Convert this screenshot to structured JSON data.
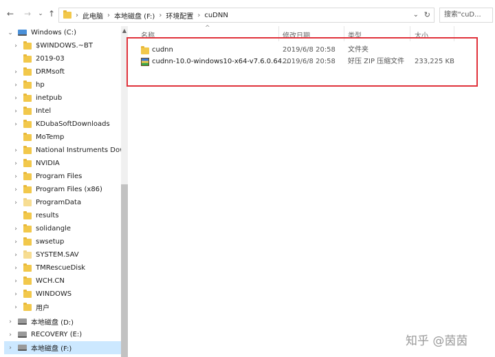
{
  "address_bar": {
    "breadcrumbs": [
      "此电脑",
      "本地磁盘 (F:)",
      "环境配置",
      "cuDNN"
    ],
    "search_placeholder": "搜索\"cuD..."
  },
  "nav_pane": {
    "items": [
      {
        "label": "Windows (C:)",
        "type": "drive",
        "expanded": true
      },
      {
        "label": "$WINDOWS.~BT",
        "type": "folder"
      },
      {
        "label": "2019-03",
        "type": "folder"
      },
      {
        "label": "DRMsoft",
        "type": "folder"
      },
      {
        "label": "hp",
        "type": "folder"
      },
      {
        "label": "inetpub",
        "type": "folder"
      },
      {
        "label": "Intel",
        "type": "folder"
      },
      {
        "label": "KDubaSoftDownloads",
        "type": "folder"
      },
      {
        "label": "MoTemp",
        "type": "folder"
      },
      {
        "label": "National Instruments Dow",
        "type": "folder"
      },
      {
        "label": "NVIDIA",
        "type": "folder"
      },
      {
        "label": "Program Files",
        "type": "folder"
      },
      {
        "label": "Program Files (x86)",
        "type": "folder"
      },
      {
        "label": "ProgramData",
        "type": "folder"
      },
      {
        "label": "results",
        "type": "folder"
      },
      {
        "label": "solidangle",
        "type": "folder"
      },
      {
        "label": "swsetup",
        "type": "folder"
      },
      {
        "label": "SYSTEM.SAV",
        "type": "folder"
      },
      {
        "label": "TMRescueDisk",
        "type": "folder"
      },
      {
        "label": "WCH.CN",
        "type": "folder"
      },
      {
        "label": "WINDOWS",
        "type": "folder"
      },
      {
        "label": "用户",
        "type": "folder"
      },
      {
        "label": "本地磁盘 (D:)",
        "type": "drive"
      },
      {
        "label": "RECOVERY (E:)",
        "type": "drive"
      },
      {
        "label": "本地磁盘 (F:)",
        "type": "drive",
        "selected": true
      }
    ]
  },
  "file_list": {
    "columns": [
      "名称",
      "修改日期",
      "类型",
      "大小"
    ],
    "rows": [
      {
        "name": "cudnn",
        "modified": "2019/6/8 20:58",
        "type": "文件夹",
        "size": "",
        "icon": "folder-icon"
      },
      {
        "name": "cudnn-10.0-windows10-x64-v7.6.0.64....",
        "modified": "2019/6/8 20:58",
        "type": "好压 ZIP 压缩文件",
        "size": "233,225 KB",
        "icon": "zip-archive-icon"
      }
    ]
  },
  "colors": {
    "highlight_border": "#e0313a",
    "folder": "#f2c84b",
    "selected_bg": "#cce8ff"
  },
  "watermark": "知乎 @茵茵"
}
